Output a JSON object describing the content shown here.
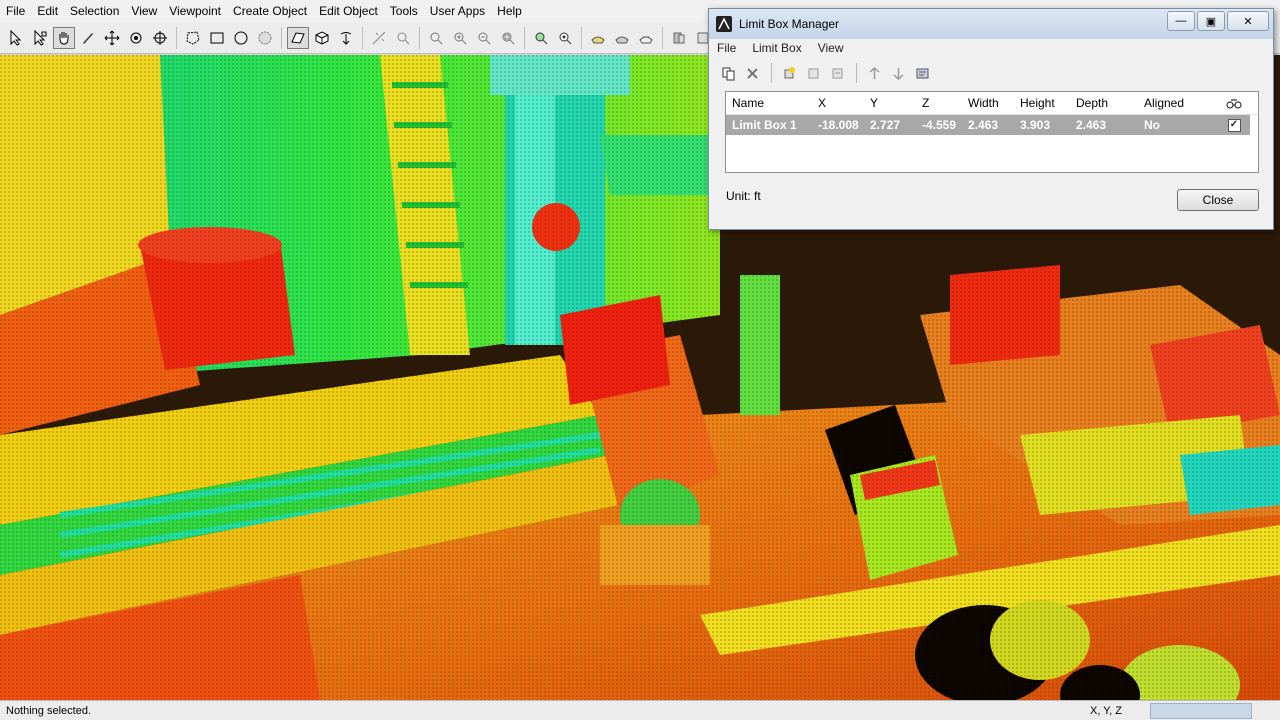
{
  "menu": [
    "File",
    "Edit",
    "Selection",
    "View",
    "Viewpoint",
    "Create Object",
    "Edit Object",
    "Tools",
    "User Apps",
    "Help"
  ],
  "toolbar_icons": [
    "select-arrow-icon",
    "select-multi-icon",
    "pan-hand-icon",
    "pencil-icon",
    "move-icon",
    "orbit-icon",
    "target-icon",
    "fence-polygon-icon",
    "rectangle-select-icon",
    "circle-select-icon",
    "sphere-select-icon",
    "limit-box-icon",
    "cube-icon",
    "cursor-fly-icon",
    "measure-icon",
    "zoom-icon",
    "zoom-fit-icon",
    "zoom-in-icon",
    "zoom-out-icon",
    "zoom-window-icon",
    "zoom-extents-icon",
    "seek-icon",
    "walk-icon",
    "fly-icon",
    "light-icon",
    "save-view-icon",
    "layers-icon"
  ],
  "status": {
    "message": "Nothing selected.",
    "coords": "X, Y, Z"
  },
  "dialog": {
    "title": "Limit Box Manager",
    "menu": [
      "File",
      "Limit Box",
      "View"
    ],
    "toolbar_icons": [
      "copy-icon",
      "delete-icon",
      "new-box-icon",
      "add-icon",
      "fit-icon",
      "move-up-icon",
      "move-down-icon",
      "settings-icon"
    ],
    "columns": {
      "name": "Name",
      "x": "X",
      "y": "Y",
      "z": "Z",
      "width": "Width",
      "height": "Height",
      "depth": "Depth",
      "aligned": "Aligned"
    },
    "rows": [
      {
        "name": "Limit Box 1",
        "x": "-18.008",
        "y": "2.727",
        "z": "-4.559",
        "width": "2.463",
        "height": "3.903",
        "depth": "2.463",
        "aligned": "No",
        "visible": "✓"
      }
    ],
    "unit": "Unit: ft",
    "close_label": "Close"
  },
  "colors": {
    "red": "#f0280f",
    "orange": "#f07a12",
    "yellow": "#f0e010",
    "green": "#2ce83a",
    "cyan": "#20e0c0",
    "dark": "#2a1808"
  }
}
